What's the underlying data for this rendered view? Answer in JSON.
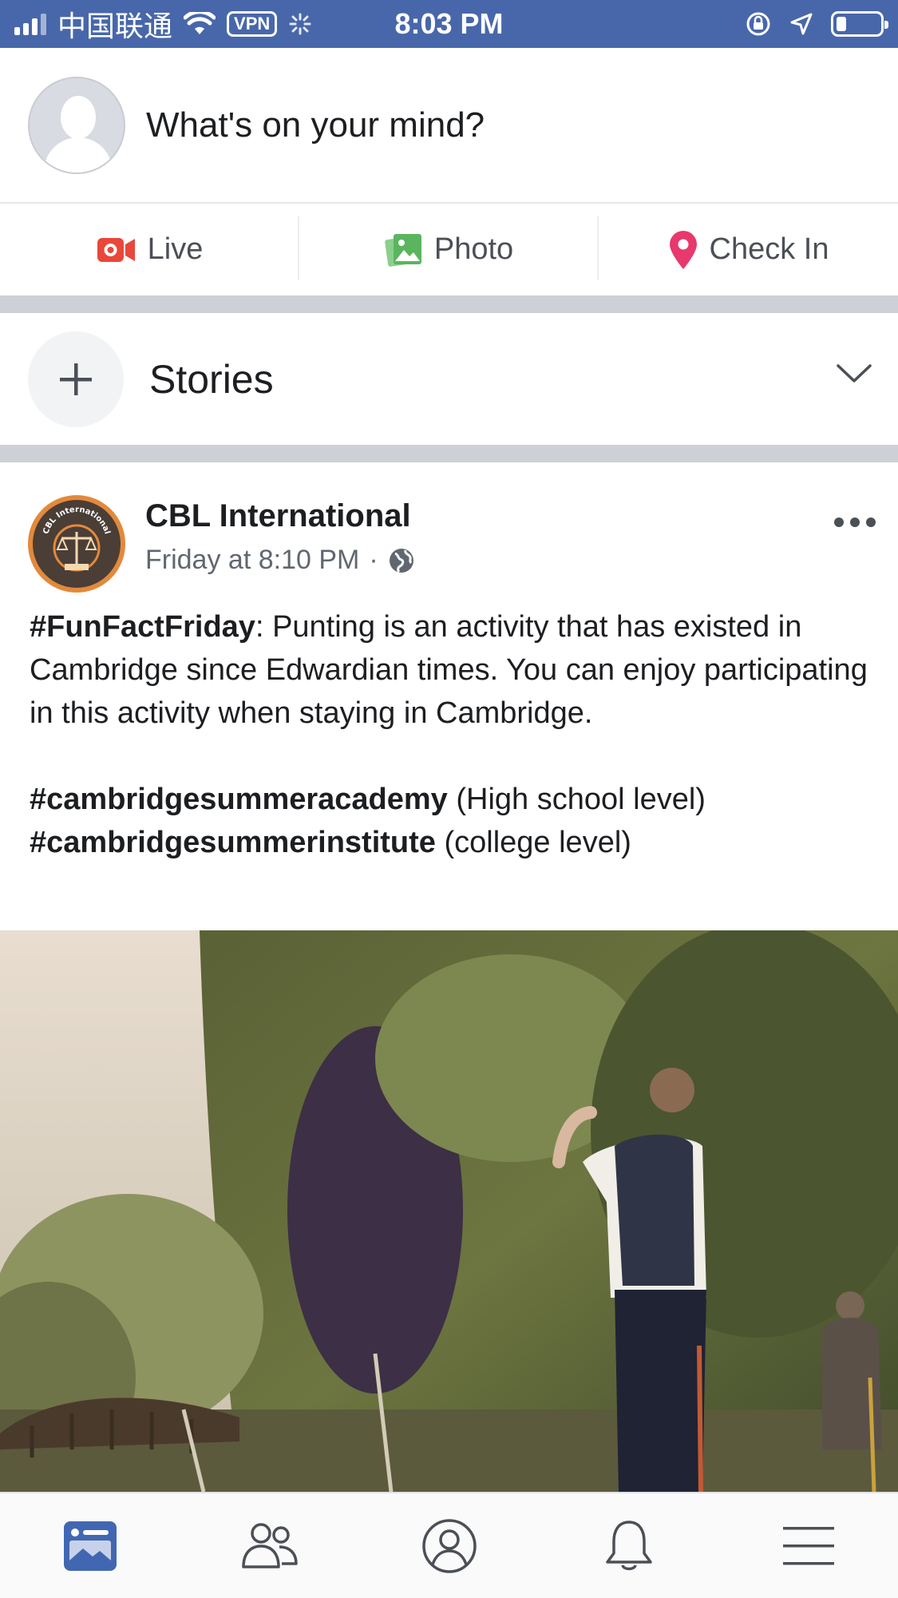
{
  "status_bar": {
    "carrier": "中国联通",
    "vpn": "VPN",
    "time": "8:03 PM"
  },
  "composer": {
    "prompt": "What's on your mind?"
  },
  "actions": [
    {
      "label": "Live",
      "icon": "live-video-icon",
      "color": "#e9473a"
    },
    {
      "label": "Photo",
      "icon": "photo-icon",
      "color": "#5ab55e"
    },
    {
      "label": "Check In",
      "icon": "location-pin-icon",
      "color": "#e8386d"
    }
  ],
  "stories": {
    "label": "Stories"
  },
  "post": {
    "page_name": "CBL International",
    "timestamp": "Friday at 8:10 PM",
    "separator": "·",
    "privacy_icon": "globe-icon",
    "logo_text": "CBL International",
    "body": {
      "lead_tag": "#FunFactFriday",
      "lead_text": ": Punting is an activity that has existed in Cambridge since Edwardian times. You can enjoy participating in this activity when staying in Cambridge.",
      "line2_tag": "#cambridgesummeracademy",
      "line2_text": " (High school level)",
      "line3_tag": "#cambridgesummerinstitute",
      "line3_text": " (college level)"
    }
  },
  "tabbar": [
    {
      "name": "news-feed",
      "icon": "news-feed-icon",
      "active": true
    },
    {
      "name": "friends",
      "icon": "friends-icon",
      "active": false
    },
    {
      "name": "profile",
      "icon": "profile-icon",
      "active": false
    },
    {
      "name": "notifications",
      "icon": "bell-icon",
      "active": false
    },
    {
      "name": "menu",
      "icon": "hamburger-menu-icon",
      "active": false
    }
  ],
  "colors": {
    "status_bar": "#4867aa",
    "active_tab": "#4267b2",
    "inactive_tab": "#4b4f56"
  }
}
